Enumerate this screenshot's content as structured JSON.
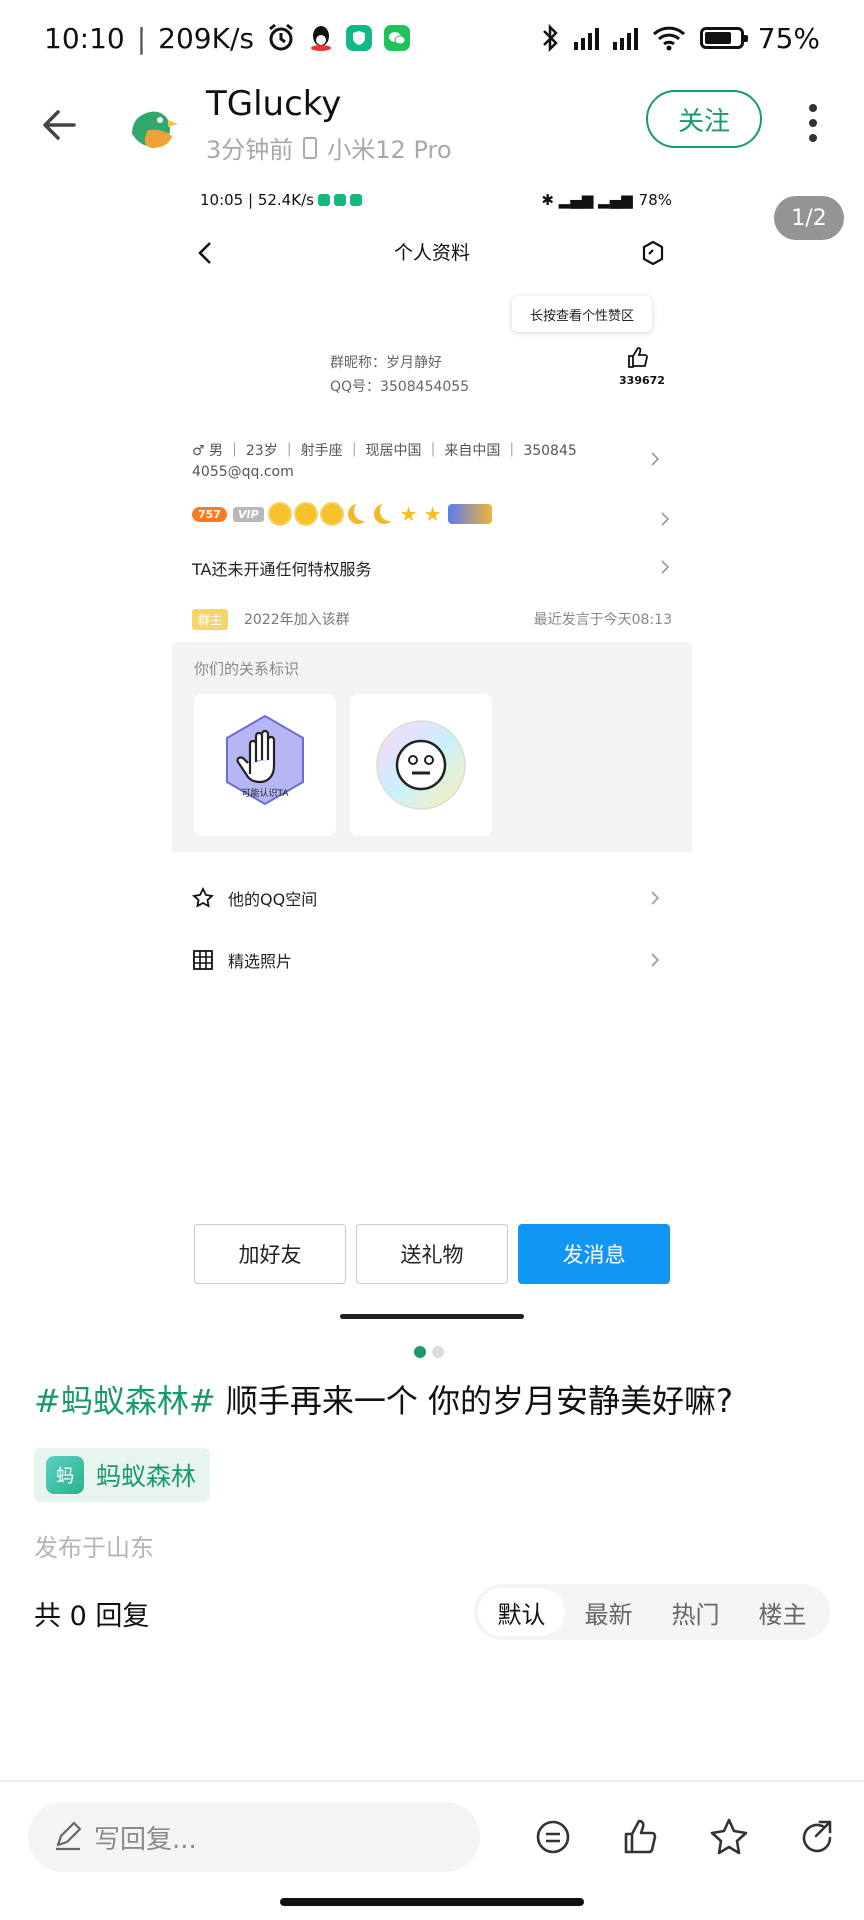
{
  "status_bar": {
    "time": "10:10",
    "net_speed": "209K/s",
    "battery": "75%",
    "battery_level": 0.75
  },
  "header": {
    "username": "TGlucky",
    "time_ago": "3分钟前",
    "device": "小米12 Pro",
    "follow_label": "关注"
  },
  "image_viewer": {
    "counter": "1/2",
    "page_index": 1,
    "page_count": 2
  },
  "inner_screenshot": {
    "status_time": "10:05",
    "status_speed": "52.4K/s",
    "status_battery": "78%",
    "title": "个人资料",
    "tooltip": "长按查看个性赞区",
    "like_count": "339672",
    "nickname": "群昵称：岁月静好",
    "qq_number": "QQ号：3508454055",
    "info_line1": "♂ 男 ｜ 23岁 ｜ 射手座 ｜ 现居中国 ｜ 来自中国 ｜ 350845",
    "info_line2": "4055@qq.com",
    "badge_level": "757",
    "badge_vip": "VIP",
    "privilege": "TA还未开通任何特权服务",
    "group_role": "群主",
    "group_join": "2022年加入该群",
    "last_post": "最近发言于今天08:13",
    "relation_title": "你们的关系标识",
    "relation_card1": "可能认识TA",
    "qzone": "他的QQ空间",
    "photos": "精选照片",
    "btn_add_friend": "加好友",
    "btn_gift": "送礼物",
    "btn_message": "发消息"
  },
  "post": {
    "tag": "#蚂蚁森林#",
    "body": " 顺手再来一个 你的岁月安静美好嘛?",
    "topic_icon_char": "蚂",
    "topic": "蚂蚁森林",
    "location": "发布于山东",
    "reply_count": "共 0 回复"
  },
  "sort_tabs": [
    {
      "label": "默认",
      "active": true
    },
    {
      "label": "最新",
      "active": false
    },
    {
      "label": "热门",
      "active": false
    },
    {
      "label": "楼主",
      "active": false
    }
  ],
  "bottom_bar": {
    "reply_placeholder": "写回复...",
    "icons": [
      "comment-icon",
      "like-icon",
      "star-icon",
      "share-icon"
    ]
  },
  "colors": {
    "brand_green": "#1a9a6a",
    "message_blue": "#1296f3"
  }
}
